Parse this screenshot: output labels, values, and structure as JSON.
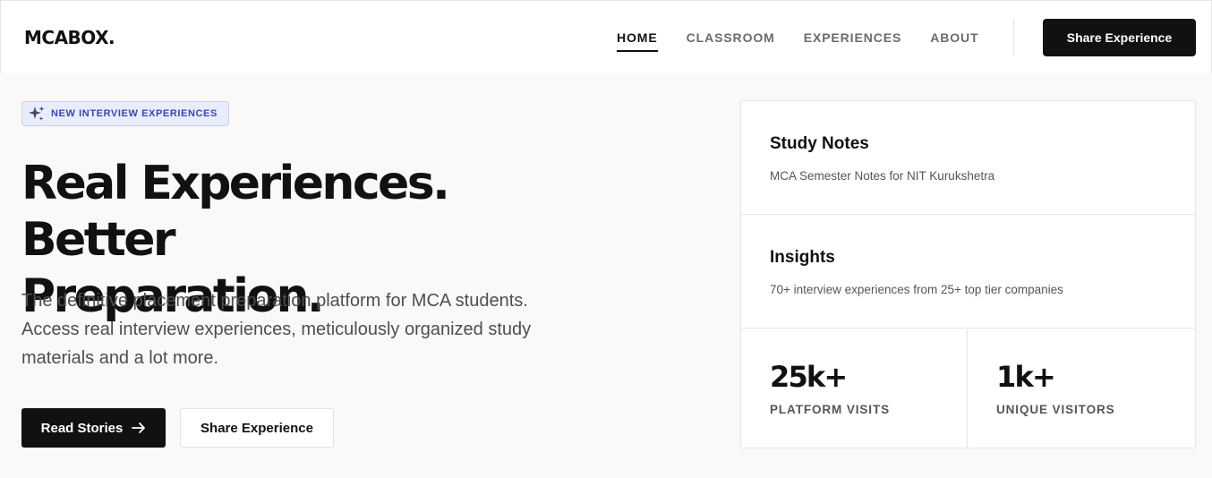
{
  "brand": "MCABOX.",
  "nav": {
    "links": [
      {
        "label": "HOME",
        "active": true
      },
      {
        "label": "CLASSROOM",
        "active": false
      },
      {
        "label": "EXPERIENCES",
        "active": false
      },
      {
        "label": "ABOUT",
        "active": false
      }
    ],
    "cta_label": "Share Experience"
  },
  "hero": {
    "badge": {
      "icon": "sparkles-icon",
      "label": "NEW INTERVIEW EXPERIENCES"
    },
    "headline_line1": "Real Experiences. Better",
    "headline_line2": "Preparation.",
    "lead": "The definitive placement preparation platform for MCA students. Access real interview experiences, meticulously organized study materials and a lot more.",
    "primary_button": {
      "label": "Read Stories",
      "icon": "arrow-right-icon"
    },
    "secondary_button": {
      "label": "Share Experience"
    }
  },
  "panel": {
    "cards": [
      {
        "title": "Study Notes",
        "description": "MCA Semester Notes for NIT Kurukshetra"
      },
      {
        "title": "Insights",
        "description": "70+ interview experiences from 25+ top tier companies"
      }
    ],
    "stats": [
      {
        "value": "25k+",
        "label": "PLATFORM VISITS"
      },
      {
        "value": "1k+",
        "label": "UNIQUE VISITORS"
      }
    ]
  },
  "colors": {
    "accent": "#3a45b0",
    "badge_bg": "#e9edfb",
    "dark": "#111111",
    "page_bg": "#faf9f7"
  }
}
